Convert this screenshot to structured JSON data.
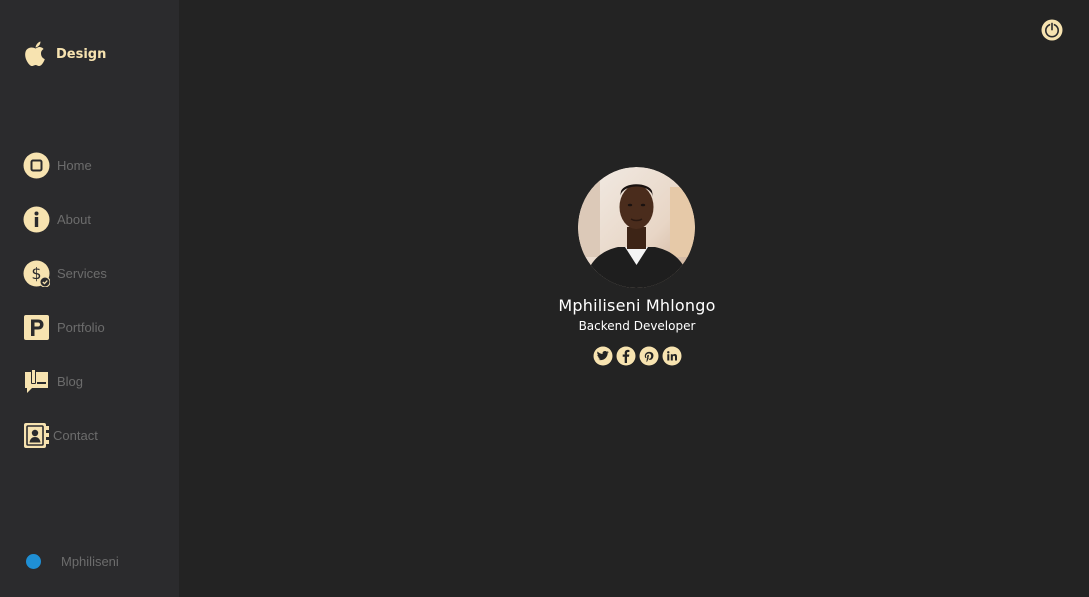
{
  "brand": {
    "name": "Design",
    "icon": "apple-icon"
  },
  "theme": {
    "accent": "#f7e3b0",
    "sidebar_bg": "#2b2b2d",
    "main_bg": "#232323",
    "muted_text": "#6c6c6c",
    "user_dot": "#1f8fd4"
  },
  "nav": [
    {
      "label": "Home",
      "icon": "home-icon"
    },
    {
      "label": "About",
      "icon": "info-icon"
    },
    {
      "label": "Services",
      "icon": "dollar-icon"
    },
    {
      "label": "Portfolio",
      "icon": "portfolio-icon"
    },
    {
      "label": "Blog",
      "icon": "blog-icon"
    },
    {
      "label": "Contact",
      "icon": "contact-icon"
    }
  ],
  "user": {
    "name": "Mphiliseni"
  },
  "profile": {
    "name": "Mphiliseni Mhlongo",
    "role": "Backend Developer",
    "socials": [
      "twitter-icon",
      "facebook-icon",
      "pinterest-icon",
      "linkedin-icon"
    ]
  }
}
